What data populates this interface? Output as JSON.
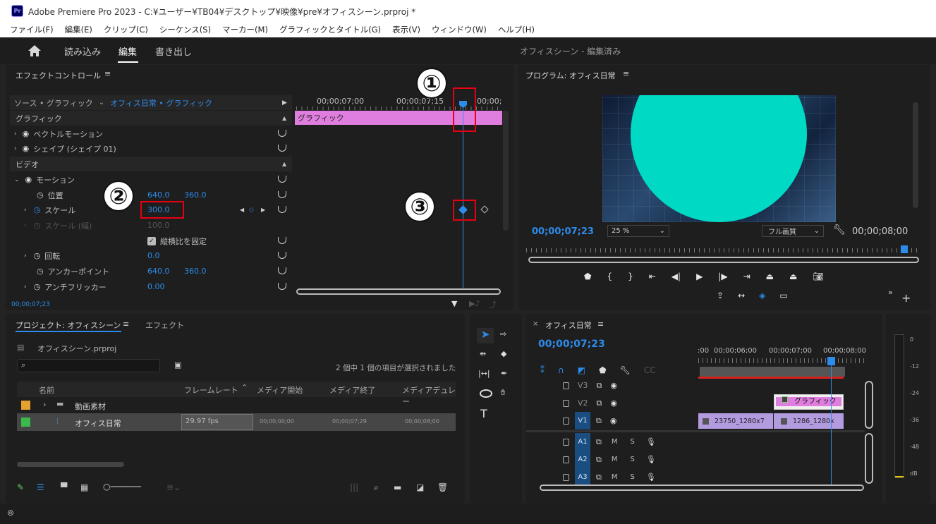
{
  "titlebar": {
    "app_badge": "Pr",
    "title": "Adobe Premiere Pro 2023 - C:¥ユーザー¥TB04¥デスクトップ¥映像¥pre¥オフィスシーン.prproj *"
  },
  "menu": [
    "ファイル(F)",
    "編集(E)",
    "クリップ(C)",
    "シーケンス(S)",
    "マーカー(M)",
    "グラフィックとタイトル(G)",
    "表示(V)",
    "ウィンドウ(W)",
    "ヘルプ(H)"
  ],
  "workspace": {
    "tabs": [
      "読み込み",
      "編集",
      "書き出し"
    ],
    "active_tab": "編集",
    "project_title": "オフィスシーン - 編集済み"
  },
  "effect_controls": {
    "panel_title": "エフェクトコントロール",
    "source": "ソース • グラフィック",
    "clip": "オフィス日常 • グラフィック",
    "section_graphic": "グラフィック",
    "vector_motion": "ベクトルモーション",
    "shape": "シェイプ (シェイプ 01)",
    "section_video": "ビデオ",
    "motion": "モーション",
    "position_label": "位置",
    "position_x": "640.0",
    "position_y": "360.0",
    "scale_label": "スケール",
    "scale_value": "300.0",
    "scale_width_label": "スケール (幅)",
    "scale_width_value": "100.0",
    "uniform_scale": "縦横比を固定",
    "rotation_label": "回転",
    "rotation_value": "0.0",
    "anchor_label": "アンカーポイント",
    "anchor_x": "640.0",
    "anchor_y": "360.0",
    "antiflicker_label": "アンチフリッカー",
    "antiflicker_value": "0.00",
    "timecode": "00;00;07;23",
    "ruler": [
      "00;00;07;00",
      "00;00;07;15",
      "00;00;"
    ],
    "clip_bar": "グラフィック"
  },
  "annotations": [
    "①",
    "②",
    "③"
  ],
  "program": {
    "title": "プログラム: オフィス日常",
    "timecode": "00;00;07;23",
    "zoom": "25 %",
    "quality": "フル画質",
    "duration": "00;00;08;00",
    "preview_color": "#00d9c3"
  },
  "project": {
    "tab_active": "プロジェクト: オフィスシーン",
    "tab_other": "エフェクト",
    "file": "オフィスシーン.prproj",
    "selection": "2 個中 1 個の項目が選択されました",
    "columns": [
      "名前",
      "フレームレート",
      "メディア開始",
      "メディア終了",
      "メディアデュレー"
    ],
    "rows": [
      {
        "color": "#e8a02e",
        "name": "動画素材",
        "fps": "",
        "start": "",
        "end": "",
        "dur": ""
      },
      {
        "color": "#3cb94b",
        "name": "オフィス日常",
        "fps": "29.97 fps",
        "start": "00;00;00;00",
        "end": "00;00;07;29",
        "dur": "00;00;08;00"
      }
    ]
  },
  "timeline": {
    "title": "オフィス日常",
    "timecode": "00;00;07;23",
    "ruler": [
      ":00",
      "00;00;06;00",
      "00;00;07;00",
      "00;00;08;00"
    ],
    "tracks": [
      "V3",
      "V2",
      "V1",
      "A1",
      "A2",
      "A3"
    ],
    "m_label": "M",
    "s_label": "S",
    "clips": {
      "v2": "グラフィック",
      "v1a": "23750_1280x7",
      "v1b": "1286_1280x"
    }
  },
  "meter": {
    "labels": [
      "0",
      "-12",
      "-24",
      "-36",
      "-48",
      "dB"
    ]
  }
}
